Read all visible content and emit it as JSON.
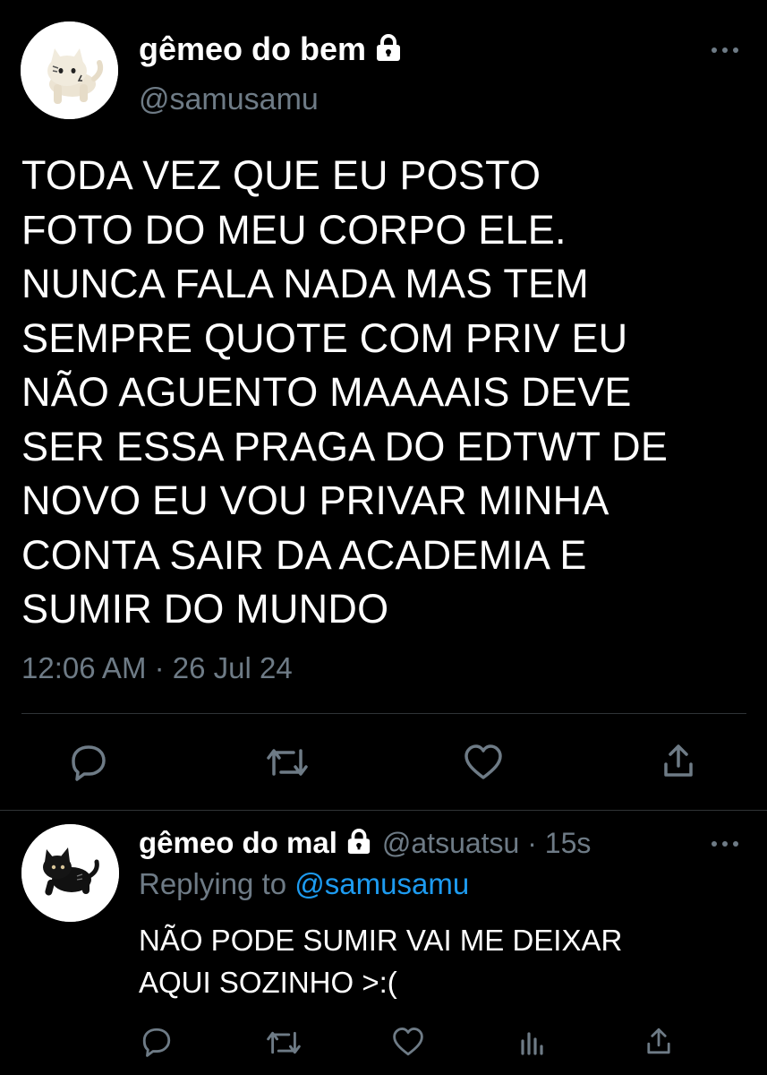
{
  "main_tweet": {
    "display_name": "gêmeo do bem",
    "handle": "@samusamu",
    "text": "TODA VEZ QUE EU POSTO\nFOTO DO MEU CORPO ELE.\nNUNCA FALA NADA MAS TEM\nSEMPRE QUOTE COM PRIV EU\nNÃO AGUENTO MAAAAIS DEVE\nSER ESSA PRAGA DO EDTWT DE\nNOVO EU VOU PRIVAR MINHA\nCONTA SAIR DA ACADEMIA E\nSUMIR DO MUNDO",
    "timestamp": "12:06 AM · 26 Jul 24",
    "avatar_icon": "white-cat-figurine-avatar",
    "actions": [
      "reply-icon",
      "retweet-icon",
      "like-icon",
      "share-icon"
    ]
  },
  "reply_tweet": {
    "display_name": "gêmeo do mal",
    "handle_time": "@atsuatsu · 15s",
    "replying_prefix": "Replying to",
    "replying_mention": "@samusamu",
    "text": "NÃO PODE SUMIR VAI ME DEIXAR\nAQUI SOZINHO >:(",
    "avatar_icon": "black-cat-figurine-avatar",
    "actions": [
      "reply-icon",
      "retweet-icon",
      "like-icon",
      "analytics-icon",
      "share-icon"
    ]
  },
  "colors": {
    "background": "#000000",
    "primary_text": "#ffffff",
    "secondary_text": "#6e7b86",
    "mention": "#1d9bf0",
    "divider": "#2f3336"
  }
}
